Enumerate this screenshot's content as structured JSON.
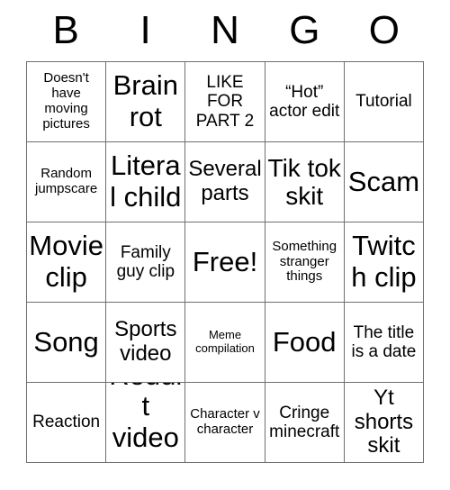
{
  "card": {
    "title_letters": [
      "B",
      "I",
      "N",
      "G",
      "O"
    ],
    "columns": 5,
    "rows": 5,
    "border_color": "#6f6f6f",
    "text_color": "#000000",
    "background_color": "#ffffff",
    "free_space": {
      "label": "Free!",
      "row": 3,
      "column": 3
    },
    "grid": [
      [
        {
          "text": "Doesn't have moving pictures",
          "size": "fs-sm"
        },
        {
          "text": "Brain rot",
          "size": "fs-xxl"
        },
        {
          "text": "LIKE FOR PART 2",
          "size": "fs-md"
        },
        {
          "text": "“Hot” actor edit",
          "size": "fs-md"
        },
        {
          "text": "Tutorial",
          "size": "fs-md"
        }
      ],
      [
        {
          "text": "Random jumpscare",
          "size": "fs-sm"
        },
        {
          "text": "Literal child",
          "size": "fs-xxl"
        },
        {
          "text": "Several parts",
          "size": "fs-lg"
        },
        {
          "text": "Tik tok skit",
          "size": "fs-xl"
        },
        {
          "text": "Scam",
          "size": "fs-xxl"
        }
      ],
      [
        {
          "text": "Movie clip",
          "size": "fs-xxl"
        },
        {
          "text": "Family guy clip",
          "size": "fs-md"
        },
        {
          "text": "Free!",
          "size": "fs-xxl"
        },
        {
          "text": "Something stranger things",
          "size": "fs-sm"
        },
        {
          "text": "Twitch clip",
          "size": "fs-xxl"
        }
      ],
      [
        {
          "text": "Song",
          "size": "fs-xxl"
        },
        {
          "text": "Sports video",
          "size": "fs-lg"
        },
        {
          "text": "Meme compilation",
          "size": "fs-xs"
        },
        {
          "text": "Food",
          "size": "fs-xxl"
        },
        {
          "text": "The title is a date",
          "size": "fs-md"
        }
      ],
      [
        {
          "text": "Reaction",
          "size": "fs-md"
        },
        {
          "text": "Reddit videos",
          "size": "fs-xxl"
        },
        {
          "text": "Character v character",
          "size": "fs-sm"
        },
        {
          "text": "Cringe minecraft",
          "size": "fs-md"
        },
        {
          "text": "Yt shorts skit",
          "size": "fs-lg"
        }
      ]
    ]
  }
}
